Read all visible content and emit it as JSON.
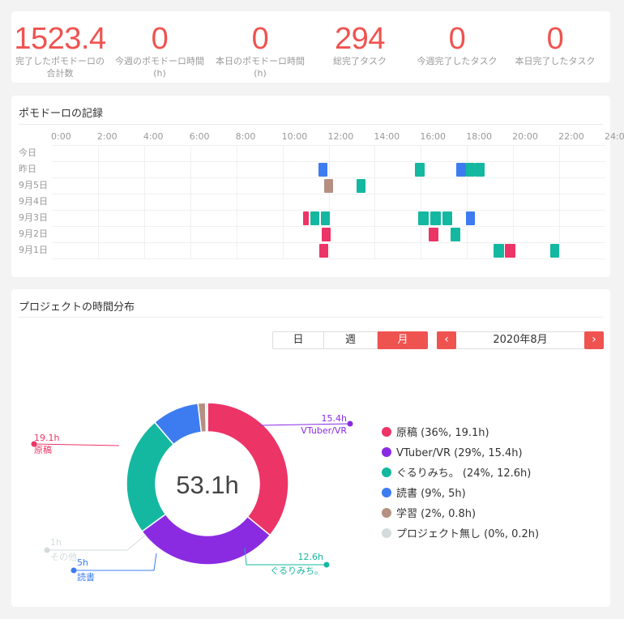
{
  "stats": [
    {
      "value": "1523.4",
      "label": "完了したポモドーロの合計数"
    },
    {
      "value": "0",
      "label": "今週のポモドーロ時間 (h)"
    },
    {
      "value": "0",
      "label": "本日のポモドーロ時間 (h)"
    },
    {
      "value": "294",
      "label": "総完了タスク"
    },
    {
      "value": "0",
      "label": "今週完了したタスク"
    },
    {
      "value": "0",
      "label": "本日完了したタスク"
    }
  ],
  "records": {
    "title": "ポモドーロの記録",
    "hours": [
      "0:00",
      "2:00",
      "4:00",
      "6:00",
      "8:00",
      "10:00",
      "12:00",
      "14:00",
      "16:00",
      "18:00",
      "20:00",
      "22:00",
      "24:00"
    ],
    "days": [
      "今日",
      "昨日",
      "9月5日",
      "9月4日",
      "9月3日",
      "9月2日",
      "9月1日"
    ],
    "blocks": [
      {
        "day": 1,
        "start": 11.55,
        "end": 11.95,
        "project": "読書"
      },
      {
        "day": 1,
        "start": 15.75,
        "end": 16.15,
        "project": "ぐるりみち。"
      },
      {
        "day": 1,
        "start": 17.55,
        "end": 17.95,
        "project": "読書"
      },
      {
        "day": 1,
        "start": 17.95,
        "end": 18.35,
        "project": "ぐるりみち。"
      },
      {
        "day": 1,
        "start": 18.35,
        "end": 18.75,
        "project": "ぐるりみち。"
      },
      {
        "day": 2,
        "start": 11.8,
        "end": 12.2,
        "project": "学習"
      },
      {
        "day": 2,
        "start": 13.2,
        "end": 13.6,
        "project": "ぐるりみち。"
      },
      {
        "day": 4,
        "start": 10.9,
        "end": 11.15,
        "project": "原稿"
      },
      {
        "day": 4,
        "start": 11.2,
        "end": 11.6,
        "project": "ぐるりみち。"
      },
      {
        "day": 4,
        "start": 11.65,
        "end": 12.05,
        "project": "ぐるりみち。"
      },
      {
        "day": 4,
        "start": 15.9,
        "end": 16.35,
        "project": "ぐるりみち。"
      },
      {
        "day": 4,
        "start": 16.4,
        "end": 16.85,
        "project": "ぐるりみち。"
      },
      {
        "day": 4,
        "start": 16.95,
        "end": 17.35,
        "project": "ぐるりみち。"
      },
      {
        "day": 4,
        "start": 17.95,
        "end": 18.35,
        "project": "読書"
      },
      {
        "day": 5,
        "start": 11.7,
        "end": 12.1,
        "project": "原稿"
      },
      {
        "day": 5,
        "start": 16.35,
        "end": 16.75,
        "project": "原稿"
      },
      {
        "day": 5,
        "start": 17.3,
        "end": 17.7,
        "project": "ぐるりみち。"
      },
      {
        "day": 6,
        "start": 11.6,
        "end": 12.0,
        "project": "原稿"
      },
      {
        "day": 6,
        "start": 19.15,
        "end": 19.6,
        "project": "ぐるりみち。"
      },
      {
        "day": 6,
        "start": 19.65,
        "end": 20.1,
        "project": "原稿"
      },
      {
        "day": 6,
        "start": 21.6,
        "end": 22.0,
        "project": "ぐるりみち。"
      }
    ]
  },
  "projects": {
    "title": "プロジェクトの時間分布",
    "tabs": [
      "日",
      "週",
      "月"
    ],
    "active_tab": "月",
    "prev_icon": "chevron-left-icon",
    "next_icon": "chevron-right-icon",
    "prev_glyph": "‹",
    "next_glyph": "›",
    "period": "2020年8月",
    "total": "53.1h",
    "items": [
      {
        "name": "原稿",
        "hours": 19.1,
        "legend": "原稿 (36%, 19.1h)",
        "color": "#ec3466",
        "callout_value": "19.1h"
      },
      {
        "name": "VTuber/VR",
        "hours": 15.4,
        "legend": "VTuber/VR (29%, 15.4h)",
        "color": "#8a2be2",
        "callout_value": "15.4h"
      },
      {
        "name": "ぐるりみち。",
        "hours": 12.6,
        "legend": "ぐるりみち。 (24%, 12.6h)",
        "color": "#14b8a0",
        "callout_value": "12.6h"
      },
      {
        "name": "読書",
        "hours": 5,
        "legend": "読書 (9%, 5h)",
        "color": "#3d7cf0",
        "callout_value": "5h"
      },
      {
        "name": "学習",
        "hours": 0.8,
        "legend": "学習 (2%, 0.8h)",
        "color": "#b59082",
        "callout_value": ""
      },
      {
        "name": "プロジェクト無し",
        "hours": 0.2,
        "legend": "プロジェクト無し (0%, 0.2h)",
        "color": "#d3dbdb",
        "callout_value": ""
      }
    ],
    "other_callout": {
      "name": "その他",
      "value": "1h",
      "color": "#d3dbdb"
    }
  }
}
